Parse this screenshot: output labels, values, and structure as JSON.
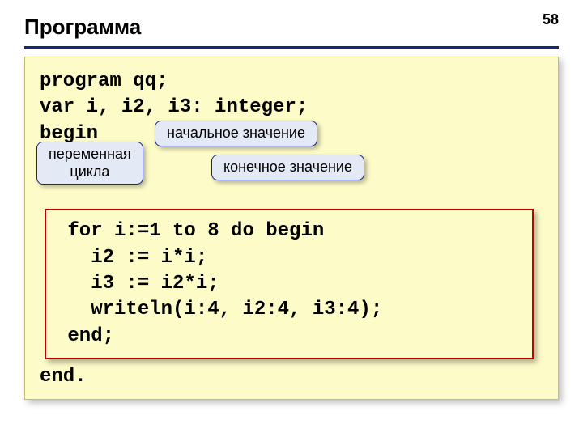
{
  "page_number": "58",
  "title": "Программа",
  "code": {
    "l1": "program qq;",
    "l2": "var i, i2, i3: integer;",
    "l3": "begin",
    "inner": {
      "l1": " for i:=1 to 8 do begin",
      "l2": "   i2 := i*i;",
      "l3": "   i3 := i2*i;",
      "l4": "   writeln(i:4, i2:4, i3:4);",
      "l5": " end;"
    },
    "l4": "end."
  },
  "callouts": {
    "initial": "начальное значение",
    "loopvar_l1": "переменная",
    "loopvar_l2": "цикла",
    "final": "конечное значение"
  }
}
